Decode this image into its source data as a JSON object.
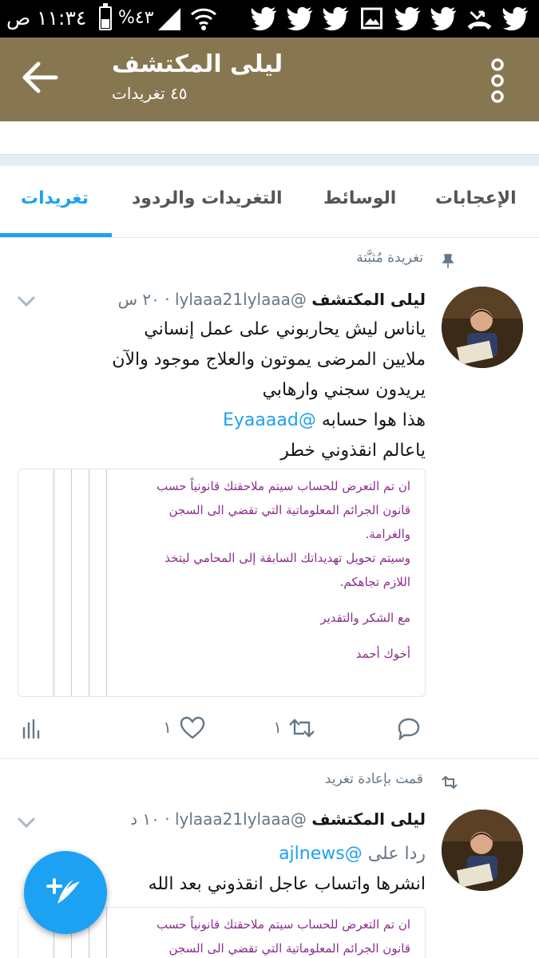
{
  "status_bar": {
    "time": "١١:٣٤ ص",
    "battery": "%٤٣",
    "battery_level": 0.43,
    "icons": [
      "twitter-icon",
      "twitter-icon",
      "twitter-icon",
      "gallery-icon",
      "twitter-icon",
      "twitter-icon",
      "missed-call-icon",
      "twitter-icon"
    ]
  },
  "header": {
    "title": "ليلى المكتشف",
    "subtitle": "٤٥ تغريدات",
    "background": "#877751"
  },
  "tabs": [
    {
      "label": "تغريدات",
      "active": true
    },
    {
      "label": "التغريدات والردود",
      "active": false
    },
    {
      "label": "الوسائط",
      "active": false
    },
    {
      "label": "الإعجابات",
      "active": false
    }
  ],
  "tweets": [
    {
      "context": "تغريدة مُثبَّتة",
      "context_icon": "pin-icon",
      "name": "ليلى المكتشف",
      "handle": "@lylaaa21lylaaa",
      "time": "٢٠ س",
      "body_lines": [
        "ياناس ليش يحاربوني على عمل إنساني",
        "ملايين المرضى يموتون والعلاج موجود والآن",
        "يريدون سجني وارهابي"
      ],
      "mention_line_prefix": "هذا هوا حسابه",
      "mention": "@Eyaaaad",
      "last_line": "ياعالم انقذوني خطر",
      "image_lines": [
        "ان تم التعرض للحساب سيتم ملاحقتك قانونياً حسب",
        "قانون الجرائم المعلوماتية التي تقضي الى السجن",
        "والغرامة.",
        "وسيتم تحويل تهديداتك السابقة إلى المحامي ليتخذ",
        "اللازم تجاهكم.",
        "",
        "مع الشكر والتقدير",
        "",
        "أخوك أحمد"
      ],
      "retweets": "١",
      "likes": "١"
    },
    {
      "context": "قمت بإعادة تغريد",
      "context_icon": "retweet-icon",
      "name": "ليلى المكتشف",
      "handle": "@lylaaa21lylaaa",
      "time": "١٠ د",
      "reply_prefix": "ردا على",
      "reply_to": "@ajlnews",
      "body": "انشرها واتساب عاجل انقذوني بعد الله",
      "image_lines": [
        "ان تم التعرض للحساب سيتم ملاحقتك قانونياً حسب",
        "قانون الجرائم المعلوماتية التي تقضي الى السجن"
      ]
    }
  ],
  "colors": {
    "accent": "#1da1f2",
    "link": "#1da1f2",
    "muted": "#657786",
    "image_text": "#8b2f8b"
  }
}
